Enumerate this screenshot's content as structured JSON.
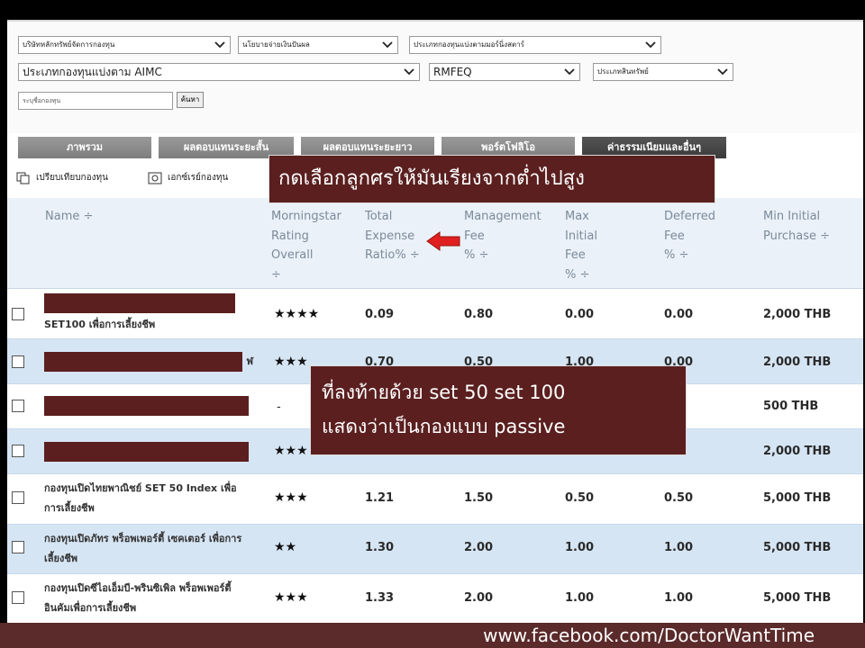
{
  "filters": {
    "company": {
      "value": "บริษัทหลักทรัพย์จัดการกองทุน"
    },
    "policy": {
      "value": "นโยบายจ่ายเงินปันผล"
    },
    "category": {
      "value": "ประเภทกองทุนแบ่งตามมอร์นิ่งสตาร์"
    },
    "fund_type": {
      "value": "ประเภทกองทุนแบ่งตาม AIMC"
    },
    "rmf": {
      "value": "RMFEQ"
    },
    "asset": {
      "value": "ประเภทสินทรัพย์"
    },
    "search_placeholder": "ระบุชื่อกองทุน",
    "search_button": "ค้นหา"
  },
  "tabs": [
    {
      "label": "ภาพรวม"
    },
    {
      "label": "ผลตอบแทนระยะสั้น"
    },
    {
      "label": "ผลตอบแทนระยะยาว"
    },
    {
      "label": "พอร์ตโฟลิโอ"
    },
    {
      "label": "ค่าธรรมเนียมและอื่นๆ"
    }
  ],
  "actions": {
    "compare": "เปรียบเทียบกองทุน",
    "export": "เอกซ์เรย์กองทุน"
  },
  "columns": [
    {
      "l1": "Name ÷",
      "l2": "",
      "l3": "",
      "l4": ""
    },
    {
      "l1": "Morningstar",
      "l2": "Rating",
      "l3": "Overall",
      "l4": "÷"
    },
    {
      "l1": "Total",
      "l2": "Expense",
      "l3": "Ratio% ÷",
      "l4": ""
    },
    {
      "l1": "Management",
      "l2": "Fee",
      "l3": "% ÷",
      "l4": ""
    },
    {
      "l1": "Max",
      "l2": "Initial",
      "l3": "Fee",
      "l4": "% ÷"
    },
    {
      "l1": "Deferred",
      "l2": "Fee",
      "l3": "% ÷",
      "l4": ""
    },
    {
      "l1": "Min Initial",
      "l2": "Purchase ÷",
      "l3": "",
      "l4": ""
    }
  ],
  "rows": [
    {
      "name1": "",
      "name2": "SET100 เพื่อการเลี้ยงชีพ",
      "rating": "★★★★",
      "ter": "0.09",
      "mgmt": "0.80",
      "init": "0.00",
      "deferred": "0.00",
      "min": "2,000 THB"
    },
    {
      "name1": "ฬ",
      "name2": "",
      "rating": "★★★",
      "ter": "0.70",
      "mgmt": "0.50",
      "init": "1.00",
      "deferred": "0.00",
      "min": "2,000 THB"
    },
    {
      "name1": "",
      "name2": "",
      "rating": "-",
      "ter": "",
      "mgmt": "",
      "init": "",
      "deferred": "0",
      "min": "500 THB"
    },
    {
      "name1": "",
      "name2": "",
      "rating": "★★★",
      "ter": "",
      "mgmt": "",
      "init": "",
      "deferred": "0",
      "min": "2,000 THB"
    },
    {
      "name1": "กองทุนเปิดไทยพาณิชย์ SET 50 Index เพื่อ",
      "name2": "การเลี้ยงชีพ",
      "rating": "★★★",
      "ter": "1.21",
      "mgmt": "1.50",
      "init": "0.50",
      "deferred": "0.50",
      "min": "5,000 THB"
    },
    {
      "name1": "กองทุนเปิดภัทร พร็อพเพอร์ตี้ เซคเตอร์ เพื่อการ",
      "name2": "เลี้ยงชีพ",
      "rating": "★★",
      "ter": "1.30",
      "mgmt": "2.00",
      "init": "1.00",
      "deferred": "1.00",
      "min": "5,000 THB"
    },
    {
      "name1": "กองทุนเปิดซีไอเอ็มบี-พรินซิเพิล พร็อพเพอร์ตี้",
      "name2": "อินคัมเพื่อการเลี้ยงชีพ",
      "rating": "★★★",
      "ter": "1.33",
      "mgmt": "2.00",
      "init": "1.00",
      "deferred": "1.00",
      "min": "5,000 THB"
    }
  ],
  "callouts": {
    "sort_note": "กดเลือกลูกศรให้มันเรียงจากต่ำไปสูง",
    "passive_line1": "ที่ลงท้ายด้วย set 50 set 100",
    "passive_line2": "แสดงว่าเป็นกองแบบ passive"
  },
  "footer": {
    "url": "www.facebook.com/DoctorWantTime"
  },
  "colors": {
    "callout_bg": "#5b1f1f",
    "row_alt": "#d6e5f4",
    "header_bg": "#ebf1f8",
    "arrow": "#e02020"
  }
}
